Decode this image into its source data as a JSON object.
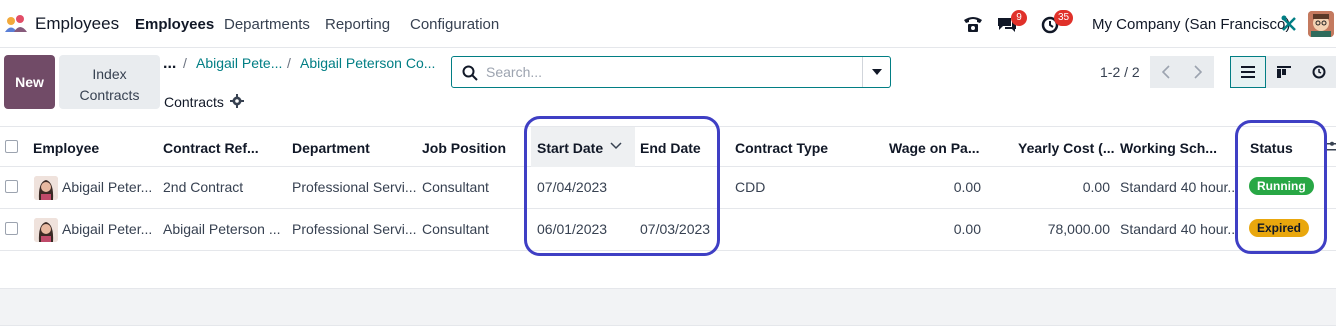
{
  "topnav": {
    "app_name": "Employees",
    "menu": [
      "Employees",
      "Departments",
      "Reporting",
      "Configuration"
    ],
    "messages_count": "9",
    "activities_count": "35",
    "company": "My Company (San Francisco)"
  },
  "control": {
    "new_label": "New",
    "index_line1": "Index",
    "index_line2": "Contracts",
    "breadcrumb_dots": "...",
    "breadcrumb_sep": "/",
    "breadcrumb_1": "Abigail Pete...",
    "breadcrumb_2": "Abigail Peterson Co...",
    "current": "Contracts",
    "search_placeholder": "Search...",
    "pager": "1-2 / 2"
  },
  "table": {
    "columns": [
      "Employee",
      "Contract Ref...",
      "Department",
      "Job Position",
      "Start Date",
      "End Date",
      "Contract Type",
      "Wage on Pa...",
      "Yearly Cost (...",
      "Working Sch...",
      "Status"
    ],
    "rows": [
      {
        "employee": "Abigail Peter...",
        "contract_ref": "2nd Contract",
        "department": "Professional Servi...",
        "job_position": "Consultant",
        "start_date": "07/04/2023",
        "end_date": "",
        "contract_type": "CDD",
        "wage": "0.00",
        "yearly_cost": "0.00",
        "working_schedule": "Standard 40 hour...",
        "status": "Running"
      },
      {
        "employee": "Abigail Peter...",
        "contract_ref": "Abigail Peterson ...",
        "department": "Professional Servi...",
        "job_position": "Consultant",
        "start_date": "06/01/2023",
        "end_date": "07/03/2023",
        "contract_type": "",
        "wage": "0.00",
        "yearly_cost": "78,000.00",
        "working_schedule": "Standard 40 hour...",
        "status": "Expired"
      }
    ]
  },
  "colors": {
    "primary": "#714b67",
    "link": "#017e84",
    "running": "#28a745",
    "expired": "#e9a70d",
    "highlight": "#3f3fc4"
  },
  "icons": [
    "app-logo-icon",
    "phone-icon",
    "chat-icon",
    "clock-icon",
    "tools-icon",
    "gear-icon",
    "search-icon",
    "caret-down-icon",
    "chevron-left-icon",
    "chevron-right-icon",
    "list-view-icon",
    "kanban-view-icon",
    "activity-view-icon",
    "sort-down-icon",
    "column-settings-icon"
  ]
}
